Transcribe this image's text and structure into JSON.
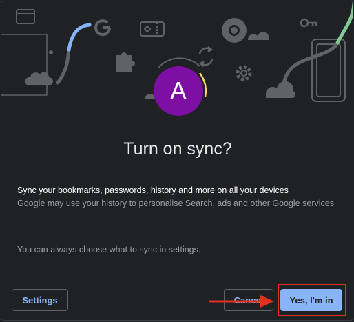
{
  "avatar": {
    "initial": "A",
    "color": "#7e0fa4"
  },
  "title": "Turn on sync?",
  "lead_text": "Sync your bookmarks, passwords, history and more on all your devices",
  "sub_text": "Google may use your history to personalise Search, ads and other Google services",
  "hint_text": "You can always choose what to sync in settings.",
  "buttons": {
    "settings": "Settings",
    "cancel": "Cancel",
    "confirm": "Yes, I'm in"
  },
  "icons": [
    "card-icon",
    "google-g-icon",
    "ticket-icon",
    "puzzle-icon",
    "sync-icon",
    "chrome-icon",
    "gear-icon",
    "key-icon",
    "cloud-icon",
    "laptop-icon",
    "phone-icon"
  ],
  "colors": {
    "background": "#202124",
    "accent": "#8ab4f8",
    "highlight": "#e0301e",
    "green": "#81c995",
    "yellow": "#fdd663"
  }
}
